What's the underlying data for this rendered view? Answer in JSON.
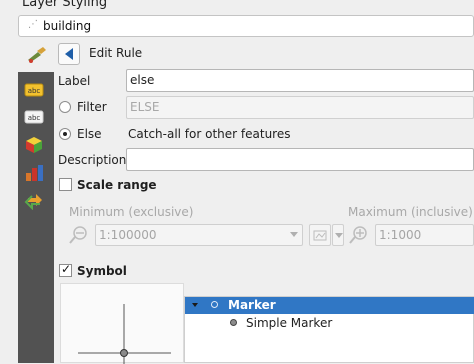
{
  "panel": {
    "title": "Layer Styling"
  },
  "layer": {
    "name": "building"
  },
  "header": {
    "edit_rule": "Edit Rule"
  },
  "rule": {
    "label_caption": "Label",
    "label_value": "else",
    "filter_caption": "Filter",
    "filter_value": "ELSE",
    "else_caption": "Else",
    "else_desc": "Catch-all for other features",
    "description_caption": "Description",
    "description_value": ""
  },
  "scale": {
    "title": "Scale range",
    "min_label": "Minimum (exclusive)",
    "max_label": "Maximum (inclusive)",
    "min_value": "1:100000",
    "max_value": "1:1000"
  },
  "symbol": {
    "title": "Symbol",
    "tree": [
      {
        "label": "Marker",
        "selected": true
      },
      {
        "label": "Simple Marker",
        "selected": false
      }
    ]
  },
  "state": {
    "filter_selected": false,
    "else_selected": true,
    "scale_checked": false,
    "symbol_checked": true
  },
  "colors": {
    "selection": "#3077c5",
    "sidebar": "#525252",
    "accent": "#1f5ea8"
  },
  "icons": {
    "sidebar": [
      "labels-icon",
      "abc-icon",
      "3d-cube-icon",
      "diagram-icon",
      "history-icon"
    ]
  }
}
